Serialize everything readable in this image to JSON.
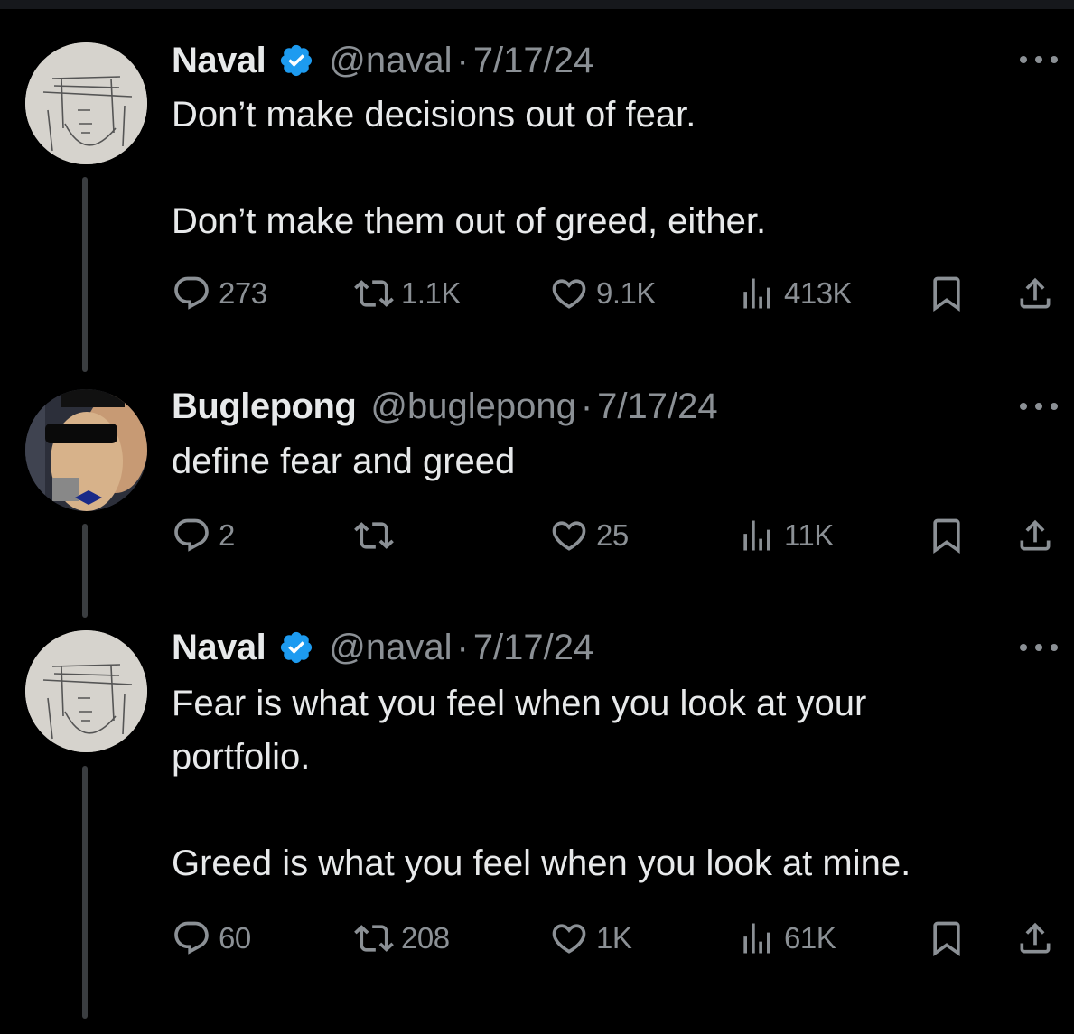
{
  "tweets": [
    {
      "author": "Naval",
      "verified": true,
      "handle": "@naval",
      "separator": "·",
      "date": "7/17/24",
      "text": "Don’t make decisions out of fear.\n\nDon’t make them out of greed, either.",
      "replies": "273",
      "retweets": "1.1K",
      "likes": "9.1K",
      "views": "413K"
    },
    {
      "author": "Buglepong",
      "verified": false,
      "handle": "@buglepong",
      "separator": "·",
      "date": "7/17/24",
      "text": "define fear and greed",
      "replies": "2",
      "retweets": "",
      "likes": "25",
      "views": "11K"
    },
    {
      "author": "Naval",
      "verified": true,
      "handle": "@naval",
      "separator": "·",
      "date": "7/17/24",
      "text": "Fear is what you feel when you look at your\nportfolio.\n\nGreed is what you feel when you look at mine.",
      "replies": "60",
      "retweets": "208",
      "likes": "1K",
      "views": "61K"
    }
  ],
  "icons": {
    "reply": "reply-icon",
    "retweet": "retweet-icon",
    "like": "heart-icon",
    "views": "views-chart-icon",
    "bookmark": "bookmark-icon",
    "share": "share-icon",
    "verified": "verified-badge-icon",
    "more": "more-dots-icon"
  },
  "colors": {
    "background": "#000000",
    "text": "#e7e9ea",
    "secondary": "#8b9095",
    "verified": "#1d9bf0",
    "thread_line": "#3a3d40"
  }
}
